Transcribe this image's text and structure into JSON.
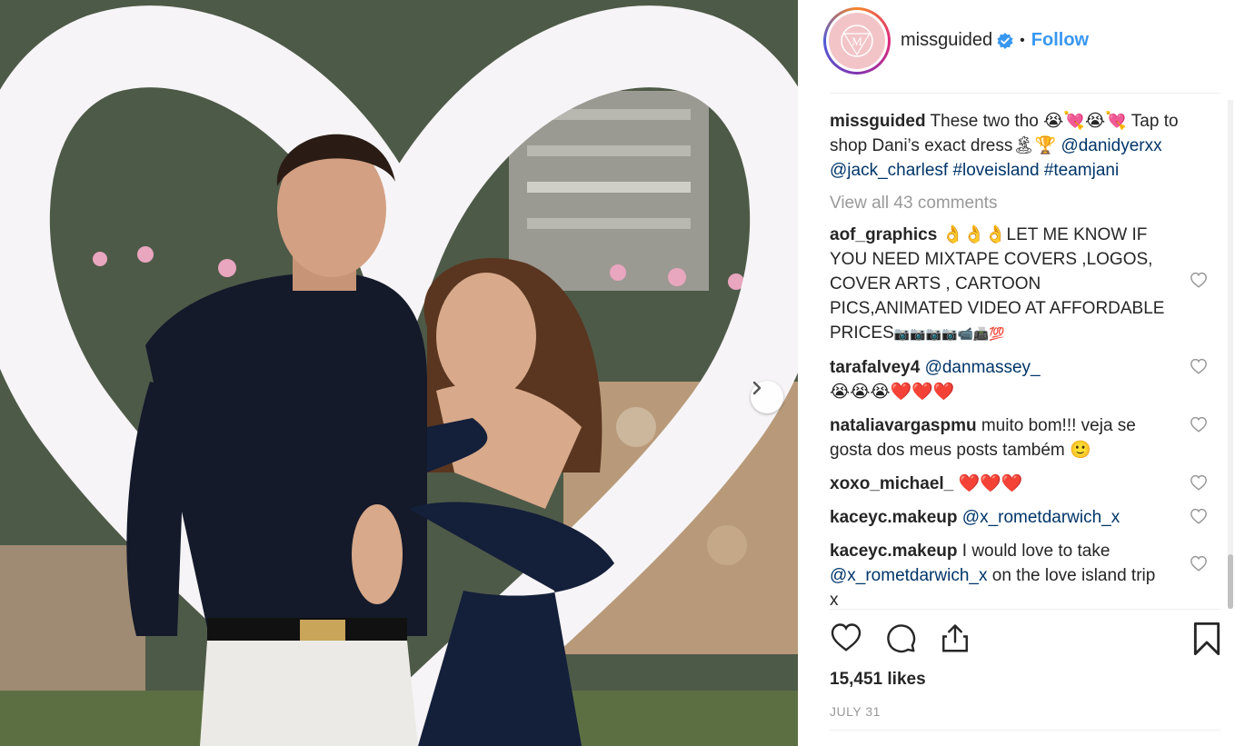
{
  "post": {
    "username": "missguided",
    "follow_label": "Follow",
    "dot": "•",
    "avatar_letter": "M"
  },
  "caption": {
    "username": "missguided",
    "text_a": "These two tho",
    "emoji_a": "😭💘😭💘",
    "text_b": "Tap to shop Dani’s exact dress",
    "emoji_b": "🏝🏆",
    "mention_1": "@danidyerxx",
    "mention_2": "@jack_charlesf",
    "hashtag_1": "#loveisland",
    "hashtag_2": "#teamjani"
  },
  "view_all": "View all 43 comments",
  "comments": [
    {
      "username": "aof_graphics",
      "emoji_pre": "👌👌👌",
      "text": "LET ME KNOW IF YOU NEED MIXTAPE COVERS ,LOGOS, COVER ARTS , CARTOON PICS,ANIMATED VIDEO AT AFFORDABLE PRICES",
      "emoji_post": "📷📷📷📷📹📠💯"
    },
    {
      "username": "tarafalvey4",
      "mention": "@danmassey_",
      "emoji_post": "😭😭😭❤️❤️❤️"
    },
    {
      "username": "nataliavargaspmu",
      "text": "muito bom!!! veja se gosta dos meus posts também",
      "emoji_post": "🙂"
    },
    {
      "username": "xoxo_michael_",
      "emoji_post": "❤️❤️❤️"
    },
    {
      "username": "kaceyc.makeup",
      "mention": "@x_rometdarwich_x"
    },
    {
      "username": "kaceyc.makeup",
      "text_pre": "I would love to take",
      "mention": "@x_rometdarwich_x",
      "text": "on the love island trip x"
    }
  ],
  "likes": "15,451 likes",
  "date": "JULY 31",
  "colors": {
    "follow": "#3897f0",
    "link": "#003569",
    "muted": "#999999",
    "heart_emoji": "#c0141c"
  },
  "icons": [
    "verified-badge-icon",
    "chevron-right-icon",
    "heart-icon",
    "comment-icon",
    "share-icon",
    "bookmark-icon"
  ]
}
